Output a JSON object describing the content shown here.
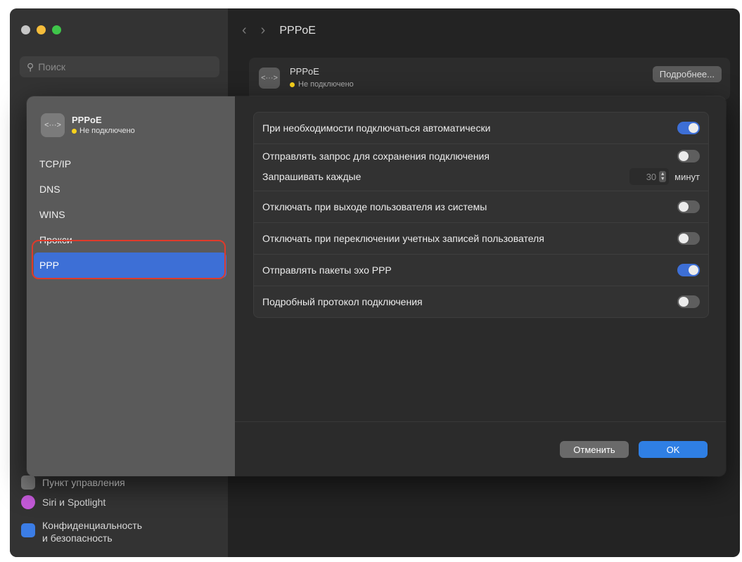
{
  "window": {
    "search_placeholder": "Поиск",
    "nav_title": "PPPoE",
    "back_icon": "chevron-left-icon",
    "forward_icon": "chevron-right-icon",
    "sidebar_visible_items": [
      {
        "label": "Пункт управления",
        "color": "#7b7b7b"
      },
      {
        "label": "Siri и Spotlight",
        "color": "#c45ad9"
      },
      {
        "label": "Конфиденциальность",
        "label2": "и безопасность",
        "color": "#3b7de6"
      }
    ],
    "card": {
      "icon": "ellipsis-icon",
      "title": "PPPoE",
      "status": "Не подключено",
      "details_button": "Подробнее..."
    }
  },
  "sheet": {
    "connection": {
      "icon": "ellipsis-icon",
      "title": "PPPoE",
      "status": "Не подключено",
      "status_color": "#f8d21c"
    },
    "nav_items": [
      {
        "label": "TCP/IP",
        "active": false
      },
      {
        "label": "DNS",
        "active": false
      },
      {
        "label": "WINS",
        "active": false
      },
      {
        "label": "Прокси",
        "active": false
      },
      {
        "label": "PPP",
        "active": true
      }
    ],
    "settings": {
      "auto_connect": {
        "label": "При необходимости подключаться автоматически",
        "on": true
      },
      "keepalive": {
        "label": "Отправлять запрос для сохранения подключения",
        "on": false
      },
      "interval": {
        "label": "Запрашивать каждые",
        "value": "30",
        "unit": "минут"
      },
      "disconnect_logout": {
        "label": "Отключать при выходе пользователя из системы",
        "on": false
      },
      "disconnect_switch": {
        "label": "Отключать при переключении учетных записей пользователя",
        "on": false
      },
      "echo": {
        "label": "Отправлять пакеты эхо PPP",
        "on": true
      },
      "verbose_log": {
        "label": "Подробный протокол подключения",
        "on": false
      }
    },
    "buttons": {
      "cancel": "Отменить",
      "ok": "OK"
    }
  },
  "colors": {
    "accent": "#3d6fd6",
    "ok_button": "#2f7fe4",
    "highlight_ring": "#e03a2a"
  }
}
